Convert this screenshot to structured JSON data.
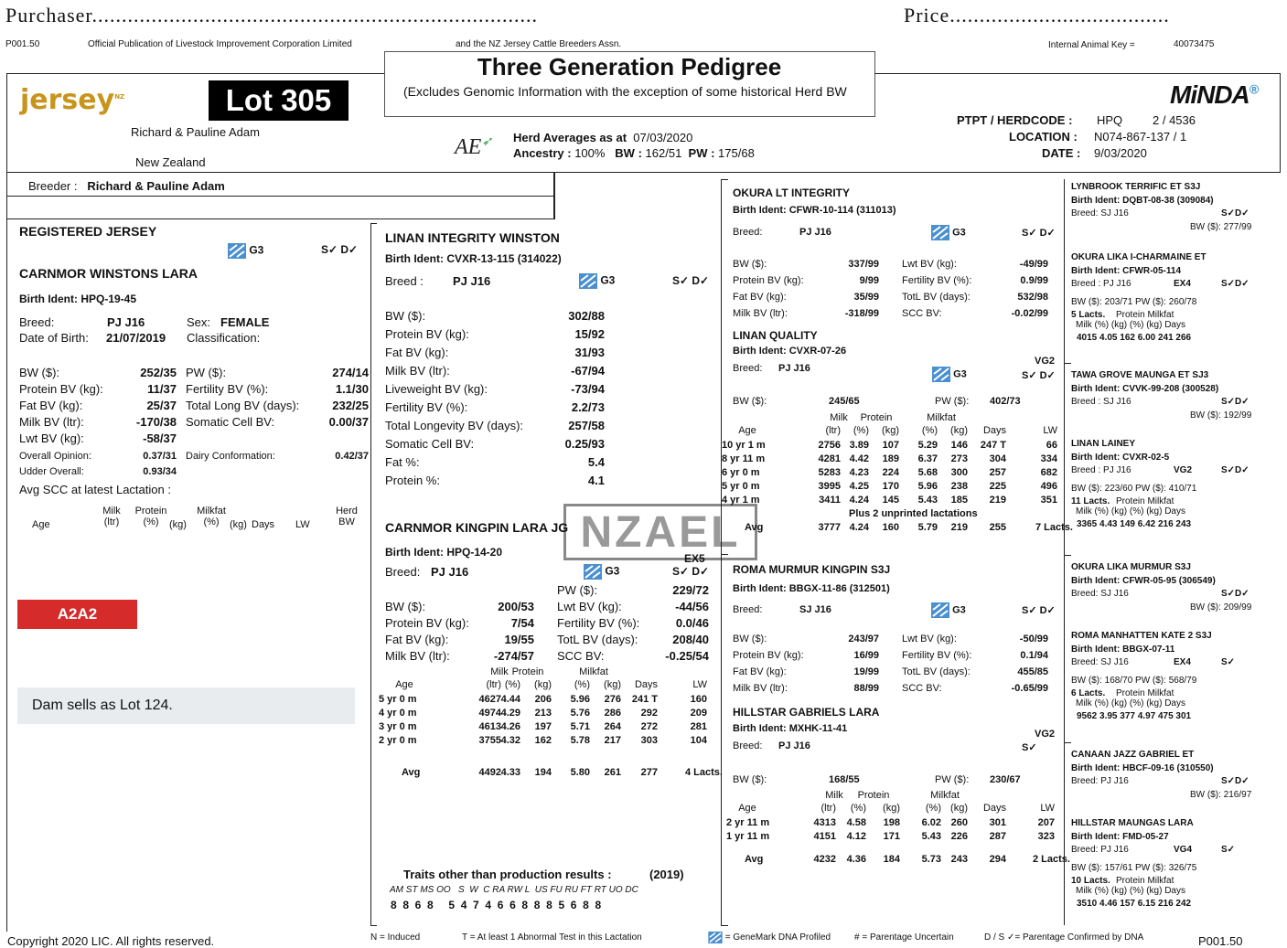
{
  "header": {
    "purchaser_label": "Purchaser",
    "price_label": "Price",
    "code_left": "P001.50",
    "official_pub": "Official Publication of Livestock Improvement Corporation Limited",
    "and_assn": "and the NZ Jersey Cattle Breeders Assn.",
    "internal_key_label": "Internal Animal Key =",
    "internal_key_value": "40073475",
    "title": "Three Generation Pedigree",
    "subtitle": "(Excludes Genomic Information with the exception of some historical Herd BW",
    "jersey_logo": "jersey",
    "jersey_logo_sup": "NZ",
    "minda_logo": "MiNDA",
    "lot_label": "Lot 305",
    "owner_name": "Richard & Pauline Adam",
    "owner_country": "New Zealand",
    "ae_logo": "AE",
    "herd_avg_label": "Herd Averages as at",
    "herd_avg_date": "07/03/2020",
    "ancestry_label": "Ancestry :",
    "ancestry_value": "100%",
    "bw_label": "BW :",
    "bw_value": "162/51",
    "pw_label": "PW :",
    "pw_value": "175/68",
    "ptpt_label": "PTPT / HERDCODE :",
    "ptpt_value": "HPQ",
    "ptpt_num": "2 / 4536",
    "location_label": "LOCATION :",
    "location_value": "N074-867-137 / 1",
    "date_label": "DATE :",
    "date_value": "9/03/2020",
    "breeder_label": "Breeder :",
    "breeder_value": "Richard & Pauline Adam"
  },
  "animal": {
    "reg": "REGISTERED JERSEY",
    "g3": "G3",
    "sd": "S✓ D✓",
    "name": "CARNMOR WINSTONS LARA",
    "birth_ident": "Birth Ident:   HPQ-19-45",
    "breed_label": "Breed:",
    "breed_value": "PJ  J16",
    "sex_label": "Sex:",
    "sex_value": "FEMALE",
    "dob_label": "Date of Birth:",
    "dob_value": "21/07/2019",
    "class_label": "Classification:",
    "rows": [
      [
        "BW ($):",
        "252/35",
        "PW ($):",
        "274/14"
      ],
      [
        "Protein BV (kg):",
        "11/37",
        "Fertility BV (%):",
        "1.1/30"
      ],
      [
        "Fat BV (kg):",
        "25/37",
        "Total Long BV (days):",
        "232/25"
      ],
      [
        "Milk BV (ltr):",
        "-170/38",
        "Somatic Cell BV:",
        "0.00/37"
      ],
      [
        "Lwt BV (kg):",
        "-58/37",
        "",
        ""
      ]
    ],
    "overall_label": "Overall Opinion:",
    "overall_value": "0.37/31",
    "dairy_label": "Dairy Conformation:",
    "dairy_value": "0.42/37",
    "udder_label": "Udder Overall:",
    "udder_value": "0.93/34",
    "avg_scc_label": "Avg SCC at latest Lactation :",
    "lact_headers": [
      "Age",
      "Milk (ltr)",
      "Protein (%)",
      "(kg)",
      "Milkfat (%)",
      "(kg)",
      "Days",
      "LW",
      "Herd BW"
    ],
    "a2": "A2A2",
    "dam_note": "Dam sells as Lot 124."
  },
  "sire": {
    "name": "LINAN INTEGRITY WINSTON",
    "birth_ident": "Birth Ident:   CVXR-13-115  (314022)",
    "breed_label": "Breed :",
    "breed_value": "PJ  J16",
    "g3": "G3",
    "sd": "S✓ D✓",
    "rows": [
      [
        "BW ($):",
        "302/88"
      ],
      [
        "Protein BV (kg):",
        "15/92"
      ],
      [
        "Fat BV (kg):",
        "31/93"
      ],
      [
        "Milk BV (ltr):",
        "-67/94"
      ],
      [
        "Liveweight BV (kg):",
        "-73/94"
      ],
      [
        "Fertility BV (%):",
        "2.2/73"
      ],
      [
        "Total Longevity BV (days):",
        "257/58"
      ],
      [
        "Somatic Cell BV:",
        "0.25/93"
      ],
      [
        "Fat %:",
        "5.4"
      ],
      [
        "Protein %:",
        "4.1"
      ]
    ]
  },
  "dam": {
    "name": "CARNMOR KINGPIN LARA JG",
    "birth_ident": "Birth Ident:   HPQ-14-20",
    "breed_label": "Breed:",
    "breed_value": "PJ  J16",
    "ex": "EX5",
    "g3": "G3",
    "sd": "S✓ D✓",
    "pw_label": "PW ($):",
    "pw_value": "229/72",
    "rows": [
      [
        "BW ($):",
        "200/53",
        "Lwt BV (kg):",
        "-44/56"
      ],
      [
        "Protein BV (kg):",
        "7/54",
        "Fertility BV (%):",
        "0.0/46"
      ],
      [
        "Fat BV (kg):",
        "19/55",
        "TotL BV (days):",
        "208/40"
      ],
      [
        "Milk BV (ltr):",
        "-274/57",
        "SCC BV:",
        "-0.25/54"
      ]
    ],
    "lact_rows": [
      [
        "5 yr  0 m",
        "4627",
        "4.44",
        "206",
        "5.96",
        "276",
        "241 T",
        "160"
      ],
      [
        "4 yr  0 m",
        "4974",
        "4.29",
        "213",
        "5.76",
        "286",
        "292",
        "209"
      ],
      [
        "3 yr  0 m",
        "4613",
        "4.26",
        "197",
        "5.71",
        "264",
        "272",
        "281"
      ],
      [
        "2 yr  0 m",
        "3755",
        "4.32",
        "162",
        "5.78",
        "217",
        "303",
        "104"
      ]
    ],
    "avg_row": [
      "Avg",
      "4492",
      "4.33",
      "194",
      "5.80",
      "261",
      "277",
      "4 Lacts."
    ],
    "traits_label": "Traits other than production results :",
    "traits_year": "(2019)",
    "traits_codes": "AM ST MS OO   S  W  C RA RW L  US FU RU FT RT UO DC",
    "traits_vals": "8  8  6  8     5  4  7  4  6  6  8  8  8  5  6  8  8"
  },
  "ss": {
    "name": "OKURA LT INTEGRITY",
    "birth_ident": "Birth Ident:   CFWR-10-114  (311013)",
    "breed_label": "Breed:",
    "breed_value": "PJ  J16",
    "g3": "G3",
    "sd": "S✓ D✓",
    "rows": [
      [
        "BW ($):",
        "337/99",
        "Lwt BV (kg):",
        "-49/99"
      ],
      [
        "Protein BV (kg):",
        "9/99",
        "Fertility BV (%):",
        "0.9/99"
      ],
      [
        "Fat BV (kg):",
        "35/99",
        "TotL BV (days):",
        "532/98"
      ],
      [
        "Milk BV (ltr):",
        "-318/99",
        "SCC BV:",
        "-0.02/99"
      ]
    ]
  },
  "sd_dam": {
    "name": "LINAN QUALITY",
    "birth_ident": "Birth Ident:   CVXR-07-26",
    "breed_label": "Breed:",
    "breed_value": "PJ  J16",
    "vg": "VG2",
    "g3": "G3",
    "sd": "S✓ D✓",
    "bw_label": "BW ($):",
    "bw_value": "245/65",
    "pw_label": "PW ($):",
    "pw_value": "402/73",
    "lact_rows": [
      [
        "10 yr  1 m",
        "2756",
        "3.89",
        "107",
        "5.29",
        "146",
        "247 T",
        "66"
      ],
      [
        "8 yr 11 m",
        "4281",
        "4.42",
        "189",
        "6.37",
        "273",
        "304",
        "334"
      ],
      [
        "6 yr  0 m",
        "5283",
        "4.23",
        "224",
        "5.68",
        "300",
        "257",
        "682"
      ],
      [
        "5 yr  0 m",
        "3995",
        "4.25",
        "170",
        "5.96",
        "238",
        "225",
        "496"
      ],
      [
        "4 yr  1 m",
        "3411",
        "4.24",
        "145",
        "5.43",
        "185",
        "219",
        "351"
      ]
    ],
    "plus_note": "Plus 2 unprinted lactations",
    "avg_row": [
      "Avg",
      "3777",
      "4.24",
      "160",
      "5.79",
      "219",
      "255",
      "7 Lacts."
    ]
  },
  "ds": {
    "name": "ROMA MURMUR KINGPIN S3J",
    "birth_ident": "Birth Ident:   BBGX-11-86  (312501)",
    "breed_label": "Breed:",
    "breed_value": "SJ  J16",
    "g3": "G3",
    "sd": "S✓ D✓",
    "rows": [
      [
        "BW ($):",
        "243/97",
        "Lwt BV (kg):",
        "-50/99"
      ],
      [
        "Protein BV (kg):",
        "16/99",
        "Fertility BV (%):",
        "0.1/94"
      ],
      [
        "Fat BV (kg):",
        "19/99",
        "TotL BV (days):",
        "455/85"
      ],
      [
        "Milk BV (ltr):",
        "88/99",
        "SCC BV:",
        "-0.65/99"
      ]
    ]
  },
  "dd": {
    "name": "HILLSTAR GABRIELS LARA",
    "birth_ident": "Birth Ident:   MXHK-11-41",
    "breed_label": "Breed:",
    "breed_value": "PJ  J16",
    "vg": "VG2",
    "s": "S✓",
    "bw_label": "BW ($):",
    "bw_value": "168/55",
    "pw_label": "PW ($):",
    "pw_value": "230/67",
    "lact_rows": [
      [
        "2 yr 11 m",
        "4313",
        "4.58",
        "198",
        "6.02",
        "260",
        "301",
        "207"
      ],
      [
        "1 yr 11 m",
        "4151",
        "4.12",
        "171",
        "5.43",
        "226",
        "287",
        "323"
      ]
    ],
    "avg_row": [
      "Avg",
      "4232",
      "4.36",
      "184",
      "5.73",
      "243",
      "294",
      "2 Lacts."
    ]
  },
  "gg": [
    {
      "name": "LYNBROOK TERRIFIC ET S3J",
      "ident": "Birth Ident:   DQBT-08-38  (309084)",
      "breed": "Breed:   SJ  J16",
      "extra": "",
      "sd": "S✓D✓",
      "bw": "BW ($): 277/99"
    },
    {
      "name": "OKURA LIKA I-CHARMAINE ET",
      "ident": "Birth Ident:   CFWR-05-114",
      "breed": "Breed :   PJ  J16",
      "extra": "EX4",
      "sd": "S✓D✓",
      "bw": "BW ($):   203/71   PW ($):  260/78",
      "lacts": "5 Lacts.",
      "prod": "4015    4.05   162    6.00   241    266"
    },
    {
      "name": "TAWA GROVE MAUNGA ET SJ3",
      "ident": "Birth Ident:   CVVK-99-208  (300528)",
      "breed": "Breed :   SJ  J16",
      "extra": "",
      "sd": "S✓D✓",
      "bw": "BW ($): 192/99"
    },
    {
      "name": "LINAN LAINEY",
      "ident": "Birth Ident:   CVXR-02-5",
      "breed": "Breed :   PJ  J16",
      "extra": "VG2",
      "sd": "S✓D✓",
      "bw": "BW ($):   223/60   PW ($):  410/71",
      "lacts": "11 Lacts.",
      "prod": "3365    4.43   149    6.42   216    243"
    },
    {
      "name": "OKURA LIKA MURMUR S3J",
      "ident": "Birth Ident:   CFWR-05-95  (306549)",
      "breed": "Breed:   SJ  J16",
      "extra": "",
      "sd": "S✓D✓",
      "bw": "BW ($): 209/99"
    },
    {
      "name": "ROMA MANHATTEN KATE 2 S3J",
      "ident": "Birth Ident:   BBGX-07-11",
      "breed": "Breed:   SJ  J16",
      "extra": "EX4",
      "sd": "S✓",
      "bw": "BW ($):   168/70   PW ($):  568/79",
      "lacts": "6 Lacts.",
      "prod": "9562    3.95   377    4.97   475    301"
    },
    {
      "name": "CANAAN JAZZ GABRIEL ET",
      "ident": "Birth Ident:   HBCF-09-16  (310550)",
      "breed": "Breed:   PJ  J16",
      "extra": "",
      "sd": "S✓D✓",
      "bw": "BW ($): 216/97"
    },
    {
      "name": "HILLSTAR MAUNGAS LARA",
      "ident": "Birth Ident:   FMD-05-27",
      "breed": "Breed:   PJ  J16",
      "extra": "VG4",
      "sd": "S✓",
      "bw": "BW ($):   157/61   PW ($):  326/75",
      "lacts": "10 Lacts.",
      "prod": "3510    4.46   157    6.15   216    242"
    }
  ],
  "gg_lact_header_1": "Protein      Milkfat",
  "gg_lact_header_2": "Milk    (%)   (kg)   (%)   (kg)  Days",
  "lact_header_line1": "Milk        Protein          Milkfat",
  "lact_header_line2": "Age       (ltr)    (%)   (kg)   (%)   (kg)   Days        LW",
  "watermark": "NZAEL",
  "footer": {
    "copyright": "Copyright 2020 LIC. All rights reserved.",
    "n_induced": "N = Induced",
    "t_abnormal": "T = At least 1 Abnormal Test in this Lactation",
    "genemark": "= GeneMark DNA Profiled",
    "parentage": "# = Parentage Uncertain",
    "ds_confirmed": "D / S ✓= Parentage Confirmed by DNA",
    "code": "P001.50"
  },
  "colors": {
    "genemark": "#4a8fd0",
    "a2": "#d52b2b",
    "jersey_logo": "#c8951c",
    "note_bg": "#e8ecef"
  },
  "icons": [
    "genemark-dna-icon",
    "ae-logo",
    "jersey-logo",
    "minda-logo"
  ]
}
